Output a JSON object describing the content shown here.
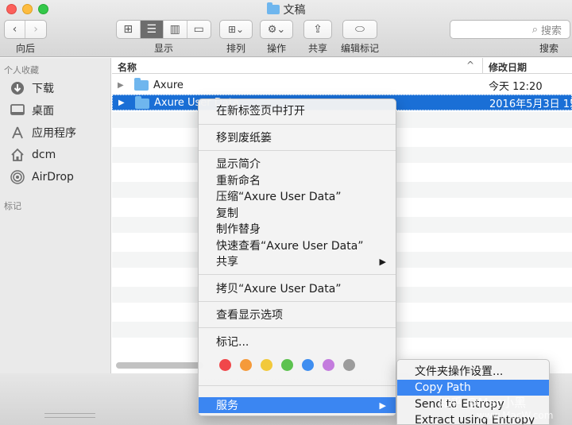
{
  "window": {
    "title": "文稿"
  },
  "toolbar": {
    "back_label": "向后",
    "view_label": "显示",
    "arrange_label": "排列",
    "action_label": "操作",
    "share_label": "共享",
    "tags_label": "编辑标记",
    "search_label": "搜索",
    "search_placeholder": "搜索"
  },
  "sidebar": {
    "favorites_title": "个人收藏",
    "items": [
      {
        "label": "下载",
        "icon": "download-icon"
      },
      {
        "label": "桌面",
        "icon": "desktop-icon"
      },
      {
        "label": "应用程序",
        "icon": "applications-icon"
      },
      {
        "label": "dcm",
        "icon": "home-icon"
      },
      {
        "label": "AirDrop",
        "icon": "airdrop-icon"
      }
    ],
    "tags_title": "标记"
  },
  "list": {
    "col_name": "名称",
    "col_date": "修改日期",
    "rows": [
      {
        "name": "Axure",
        "date": "今天 12:20"
      },
      {
        "name": "Axure User Data",
        "date": "2016年5月3日 15"
      }
    ]
  },
  "context_menu": {
    "items": [
      {
        "label": "在新标签页中打开"
      },
      {
        "label": "移到废纸篓"
      },
      {
        "label": "显示简介"
      },
      {
        "label": "重新命名"
      },
      {
        "label": "压缩“Axure User Data”"
      },
      {
        "label": "复制"
      },
      {
        "label": "制作替身"
      },
      {
        "label": "快速查看“Axure User Data”"
      },
      {
        "label": "共享"
      },
      {
        "label": "拷贝“Axure User Data”"
      },
      {
        "label": "查看显示选项"
      },
      {
        "label": "标记..."
      },
      {
        "label": "服务"
      }
    ],
    "tag_colors": [
      "#f0474a",
      "#f59a3a",
      "#f2c93b",
      "#5cc24f",
      "#3f8ef0",
      "#c47cde",
      "#9c9c9c"
    ]
  },
  "submenu": {
    "items": [
      {
        "label": "文件夹操作设置..."
      },
      {
        "label": "Copy Path"
      },
      {
        "label": "Send to Entropy"
      },
      {
        "label": "Extract using Entropy"
      }
    ]
  },
  "watermark": {
    "line1": "知乎 @Mac小黑",
    "line2": "www.MacW.com"
  }
}
